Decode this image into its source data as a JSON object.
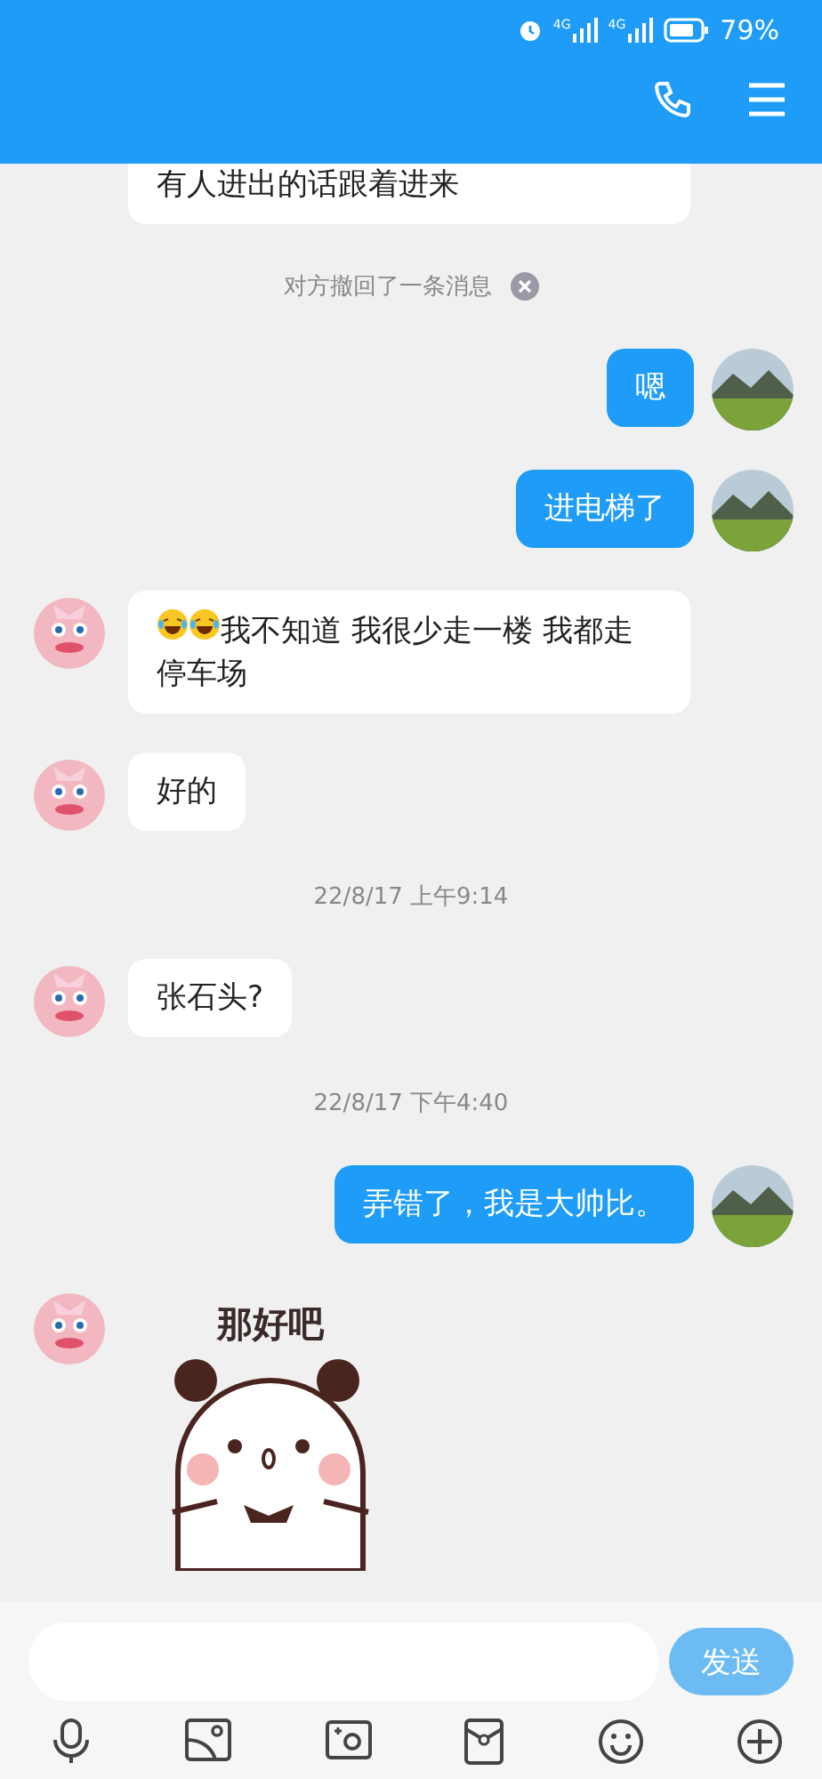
{
  "status_bar": {
    "networks": [
      "4G",
      "4G"
    ],
    "battery": "79%"
  },
  "messages": [
    {
      "kind": "continued",
      "text": "有人进出的话跟着进来"
    },
    {
      "kind": "recall",
      "text": "对方撤回了一条消息"
    },
    {
      "kind": "outgoing",
      "text": "嗯"
    },
    {
      "kind": "outgoing",
      "text": "进电梯了"
    },
    {
      "kind": "incoming",
      "emojis": [
        {
          "kind": "laugh-cry"
        },
        {
          "kind": "laugh-cry"
        }
      ],
      "text": "我不知道 我很少走一楼 我都走停车场"
    },
    {
      "kind": "incoming",
      "text": "好的"
    },
    {
      "kind": "time",
      "text": "22/8/17 上午9:14"
    },
    {
      "kind": "incoming",
      "text": "张石头?"
    },
    {
      "kind": "time",
      "text": "22/8/17 下午4:40"
    },
    {
      "kind": "outgoing",
      "text": "弄错了，我是大帅比。"
    },
    {
      "kind": "sticker",
      "caption": "那好吧"
    }
  ],
  "composer": {
    "send": "发送"
  }
}
